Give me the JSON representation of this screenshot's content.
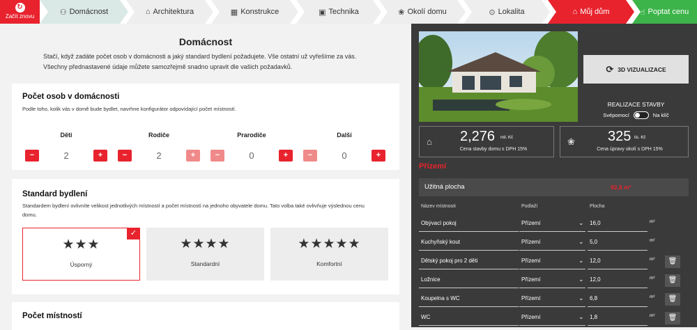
{
  "topbar": {
    "restart_label": "Začít znovu",
    "steps": [
      {
        "label": "Domácnost",
        "icon": "people-icon"
      },
      {
        "label": "Architektura",
        "icon": "house-icon"
      },
      {
        "label": "Konstrukce",
        "icon": "building-icon"
      },
      {
        "label": "Technika",
        "icon": "technology-icon"
      },
      {
        "label": "Okolí domu",
        "icon": "plant-icon"
      },
      {
        "label": "Lokalita",
        "icon": "location-pin-icon"
      },
      {
        "label": "Můj dům",
        "icon": "house-icon"
      },
      {
        "label": "Poptat cenu",
        "icon": "pointer-icon"
      }
    ]
  },
  "left": {
    "title": "Domácnost",
    "intro": "Stačí, když zadáte počet osob v domácnosti a jaký standard bydlení požadujete. Vše ostatní už vyřešíme za vás. Všechny přednastavené údaje můžete samozřejmě snadno upravit dle vašich požadavků.",
    "persons": {
      "title": "Počet osob v domácnosti",
      "desc": "Podle toho, kolik vás v domě bude bydlet, navrhne konfigurátor odpovídající počet místností.",
      "counters": [
        {
          "label": "Děti",
          "value": "2"
        },
        {
          "label": "Rodiče",
          "value": "2"
        },
        {
          "label": "Prarodiče",
          "value": "0"
        },
        {
          "label": "Další",
          "value": "0"
        }
      ]
    },
    "standard": {
      "title": "Standard bydlení",
      "desc": "Standardem bydlení ovlivníte velikost jednotlivých místností a počet místností na jednoho obyvatele domu. Tato volba také ovlivňuje výslednou cenu domu.",
      "options": [
        {
          "stars": "★★★",
          "label": "Úsporný",
          "selected": true
        },
        {
          "stars": "★★★★",
          "label": "Standardní",
          "selected": false
        },
        {
          "stars": "★★★★★",
          "label": "Komfortní",
          "selected": false
        }
      ]
    },
    "rooms_count_title": "Počet místností"
  },
  "right": {
    "viz_button": "3D VIZUALIZACE",
    "realization_title": "REALIZACE STAVBY",
    "toggle_left": "Svépomocí",
    "toggle_right": "Na klíč",
    "price_house": {
      "value": "2,276",
      "unit": "mil. Kč",
      "caption": "Cena stavby domu s DPH 15%"
    },
    "price_garden": {
      "value": "325",
      "unit": "tis. Kč",
      "caption": "Cena úpravy okolí s DPH 15%"
    },
    "floor": "Přízemí",
    "usable_label": "Užitná plocha",
    "usable_value": "92,8 m²",
    "columns": {
      "room": "Název místnosti",
      "floor": "Podlaží",
      "area": "Plocha"
    },
    "rooms": [
      {
        "name": "Obývací pokoj",
        "floor": "Přízemí",
        "area": "16,0",
        "unit": "m²",
        "deletable": false
      },
      {
        "name": "Kuchyňský kout",
        "floor": "Přízemí",
        "area": "5,0",
        "unit": "m²",
        "deletable": false
      },
      {
        "name": "Dětský pokoj pro 2 děti",
        "floor": "Přízemí",
        "area": "12,0",
        "unit": "m²",
        "deletable": true
      },
      {
        "name": "Ložnice",
        "floor": "Přízemí",
        "area": "12,0",
        "unit": "m²",
        "deletable": true
      },
      {
        "name": "Koupelna s WC",
        "floor": "Přízemí",
        "area": "6,8",
        "unit": "m²",
        "deletable": true
      },
      {
        "name": "WC",
        "floor": "Přízemí",
        "area": "1,8",
        "unit": "m²",
        "deletable": true
      }
    ]
  },
  "colors": {
    "accent": "#e8232e",
    "success": "#3db44a",
    "panel": "#3a3a3a"
  }
}
